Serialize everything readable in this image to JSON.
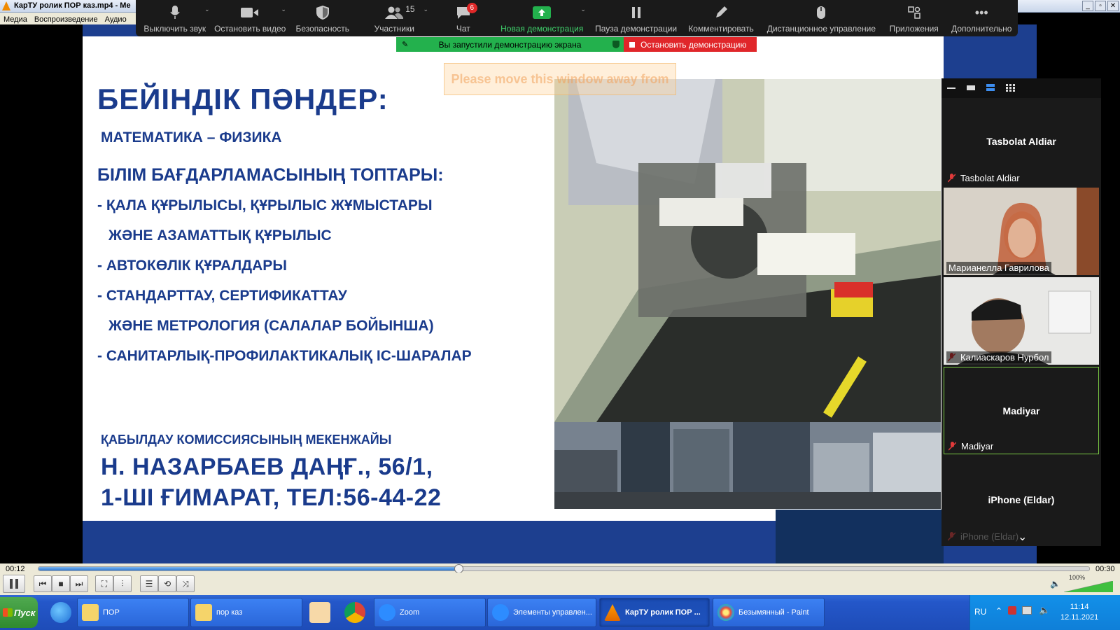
{
  "vlc": {
    "title": "КарТУ ролик ПОР каз.mp4 - Me",
    "menu": [
      "Медиа",
      "Воспроизведение",
      "Аудио"
    ],
    "time_current": "00:12",
    "time_total": "00:30",
    "progress": 0.4,
    "volume": "100%"
  },
  "zoom_toolbar": {
    "mute": "Выключить звук",
    "stop_video": "Остановить видео",
    "security": "Безопасность",
    "participants": "Участники",
    "participants_count": "15",
    "chat": "Чат",
    "chat_badge": "6",
    "new_share": "Новая демонстрация",
    "pause_share": "Пауза демонстрации",
    "annotate": "Комментировать",
    "remote_control": "Дистанционное управление",
    "apps": "Приложения",
    "more": "Дополнительно"
  },
  "share_banner": {
    "message": "Вы запустили демонстрацию экрана",
    "stop": "Остановить демонстрацию"
  },
  "overlay_note": "Please move this window away from",
  "slide": {
    "heading": "БЕЙІНДІК ПӘНДЕР:",
    "subjects": "МАТЕМАТИКА – ФИЗИКА",
    "programs_heading": "БІЛІМ БАҒДАРЛАМАСЫНЫҢ ТОПТАРЫ:",
    "items": [
      "- ҚАЛА ҚҰРЫЛЫСЫ, ҚҰРЫЛЫС ЖҰМЫСТАРЫ",
      "ЖӘНЕ АЗАМАТТЫҚ ҚҰРЫЛЫС",
      "- АВТОКӨЛІК ҚҰРАЛДАРЫ",
      "- СТАНДАРТТАУ, СЕРТИФИКАТТАУ",
      "ЖӘНЕ МЕТРОЛОГИЯ (САЛАЛАР БОЙЫНША)",
      "- САНИТАРЛЫҚ-ПРОФИЛАКТИКАЛЫҚ ІС-ШАРАЛАР"
    ],
    "address_heading": "ҚАБЫЛДАУ КОМИССИЯСЫНЫҢ МЕКЕНЖАЙЫ",
    "address_line1": "Н. НАЗАРБАЕВ ДАҢҒ., 56/1,",
    "address_line2": "1-ШІ ҒИМАРАТ, ТЕЛ:56-44-22"
  },
  "participants": [
    {
      "name": "Tasbolat Aldiar",
      "center": "Tasbolat Aldiar"
    },
    {
      "name": "Марианелла Гаврилова"
    },
    {
      "name": "Калиаскаров Нурбол"
    },
    {
      "name": "Madiyar",
      "center": "Madiyar"
    },
    {
      "name": "iPhone (Eldar)",
      "center": "iPhone (Eldar)"
    }
  ],
  "taskbar": {
    "start": "Пуск",
    "windows": [
      "ПОР",
      "пор каз",
      "Zoom",
      "Элементы управлен...",
      "КарТУ ролик ПОР ...",
      "Безымянный - Paint"
    ],
    "lang": "RU",
    "time": "11:14",
    "date": "12.11.2021"
  },
  "colors": {
    "slide_blue": "#1a3b8c",
    "zoom_green": "#23b14d",
    "stop_red": "#e0262a"
  }
}
